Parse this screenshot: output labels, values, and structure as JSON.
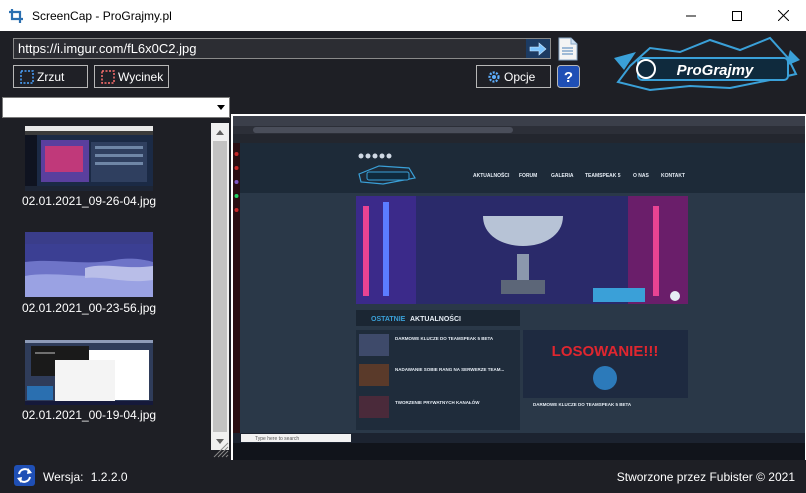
{
  "window": {
    "title": "ScreenCap - ProGrajmy.pl",
    "app_icon": "crop-icon",
    "controls": [
      "minimize-icon",
      "maximize-icon",
      "close-icon"
    ]
  },
  "toolbar": {
    "url_value": "https://i.imgur.com/fL6x0C2.jpg",
    "go_icon": "arrow-right-icon",
    "document_icon": "document-icon",
    "zrzut_label": "Zrzut",
    "wycinek_label": "Wycinek",
    "opcje_label": "Opcje",
    "help_icon": "help-icon"
  },
  "logo": {
    "text": "ProGrajmy",
    "color": "#3aa0d8"
  },
  "sidebar": {
    "dropdown_value": "",
    "items": [
      {
        "label": "02.01.2021_09-26-04.jpg"
      },
      {
        "label": "02.01.2021_00-23-56.jpg"
      },
      {
        "label": "02.01.2021_00-19-04.jpg"
      }
    ]
  },
  "preview": {
    "site_menu": [
      "AKTUALNOŚCI",
      "FORUM",
      "GALERIA",
      "TEAMSPEAK 5",
      "O NAS",
      "KONTAKT"
    ],
    "news_heading_a": "OSTATNIE",
    "news_heading_b": "AKTUALNOŚCI",
    "news_items": [
      "DARMOWE KLUCZE DO TEAMSPEAK 5 BETA",
      "NADAWANIE SOBIE RANG NA SERWERZE TEAM...",
      "TWORZENIE PRYWATNYCH KANAŁÓW"
    ],
    "banner_text": "LOSOWANIE!!!",
    "feature_title": "DARMOWE KLUCZE DO TEAMSPEAK 5 BETA",
    "taskbar_search": "Type here to search",
    "accent_color": "#3aa0d8"
  },
  "footer": {
    "refresh_icon": "refresh-icon",
    "version_label": "Wersja:",
    "version_value": "1.2.2.0",
    "credits": "Stworzone przez Fubister © 2021"
  }
}
